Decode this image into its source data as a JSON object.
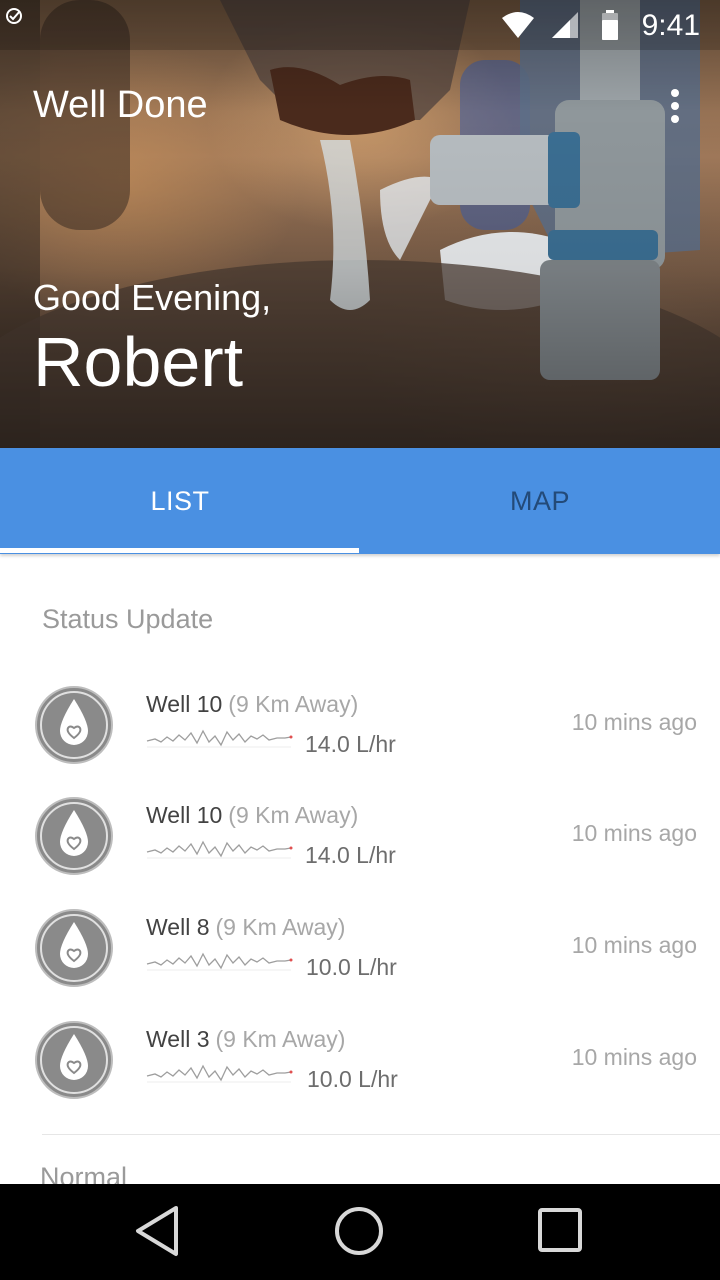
{
  "status_bar": {
    "time": "9:41",
    "icons": [
      "notification-icon",
      "wifi-icon",
      "cell-signal-icon",
      "battery-icon"
    ]
  },
  "app": {
    "title": "Well Done"
  },
  "hero": {
    "greeting": "Good Evening,",
    "user_name": "Robert"
  },
  "tabs": [
    {
      "label": "LIST",
      "selected": true
    },
    {
      "label": "MAP",
      "selected": false
    }
  ],
  "colors": {
    "tab_bar": "#4a90e2",
    "tab_inactive_text": "#234a78",
    "secondary_text": "#a7a7a7"
  },
  "status_section": {
    "title": "Status Update",
    "wells": [
      {
        "name": "Well 10",
        "distance": "(9 Km Away)",
        "rate": "14.0 L/hr",
        "time_ago": "10 mins ago",
        "icon": "water-drop-heart-icon"
      },
      {
        "name": "Well 10",
        "distance": "(9 Km Away)",
        "rate": "14.0 L/hr",
        "time_ago": "10 mins ago",
        "icon": "water-drop-heart-icon"
      },
      {
        "name": "Well 8",
        "distance": "(9 Km Away)",
        "rate": "10.0 L/hr",
        "time_ago": "10 mins ago",
        "icon": "water-drop-heart-icon"
      },
      {
        "name": "Well 3",
        "distance": "(9 Km Away)",
        "rate": "10.0 L/hr",
        "time_ago": "10 mins ago",
        "icon": "water-drop-heart-icon"
      }
    ]
  },
  "normal_section": {
    "title": "Normal"
  },
  "nav_bar": {
    "buttons": [
      "back-icon",
      "home-icon",
      "recents-icon"
    ]
  }
}
